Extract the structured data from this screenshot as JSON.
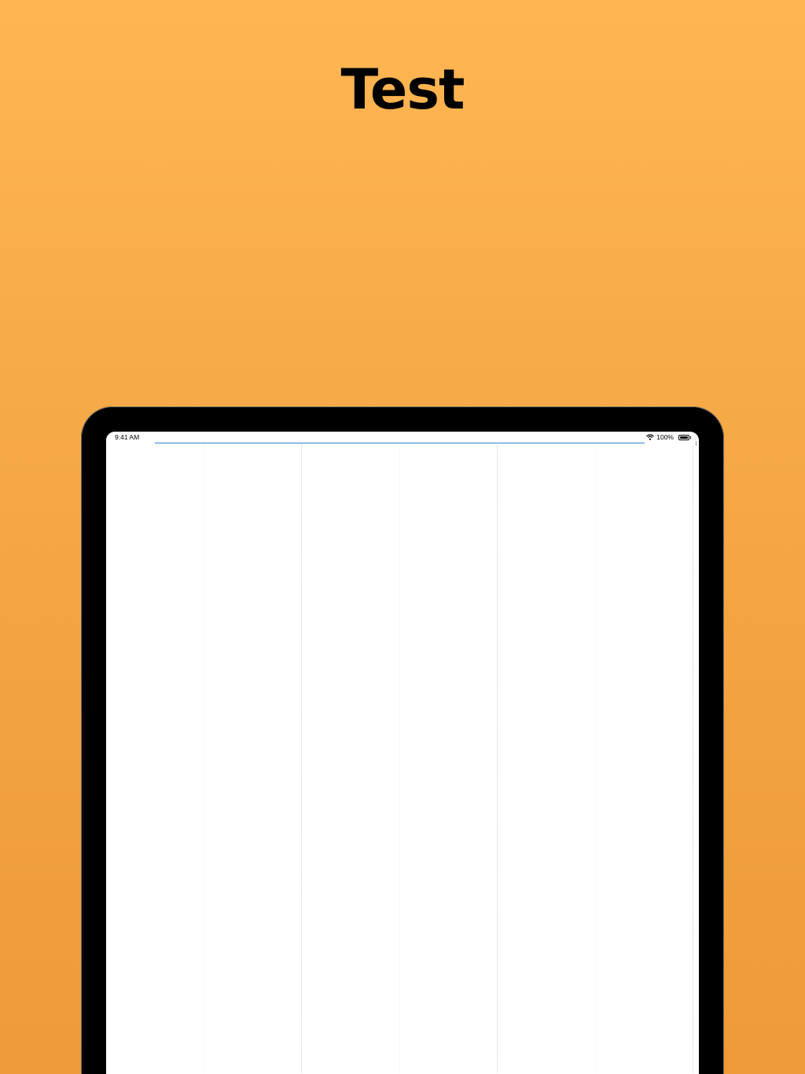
{
  "header": {
    "title": "Test"
  },
  "status_bar": {
    "time": "9:41 AM",
    "battery_percent": "100%",
    "wifi_icon": "wifi-icon",
    "battery_icon": "battery-icon"
  },
  "colors": {
    "background_top": "#ffb652",
    "background_bottom": "#ee9a39",
    "device_bezel": "#000000",
    "screen": "#ffffff",
    "accent_line": "#2e7fd0"
  }
}
